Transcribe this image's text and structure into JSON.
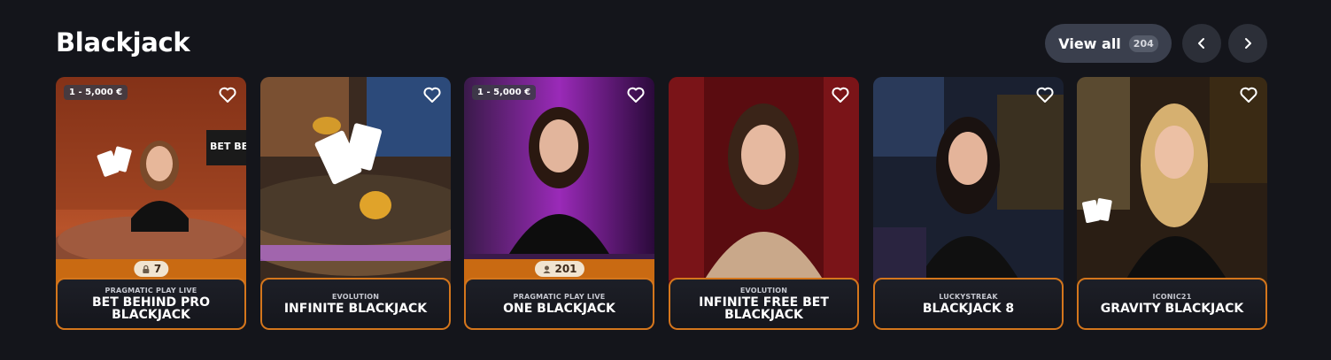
{
  "section": {
    "title": "Blackjack",
    "view_all_label": "View all",
    "view_all_count": "204"
  },
  "icons": {
    "prev": "chevron-left-icon",
    "next": "chevron-right-icon",
    "favorite": "heart-outline-icon",
    "seats_lock": "lock-icon",
    "seats_players": "players-icon"
  },
  "colors": {
    "background": "#14151b",
    "accent_orange": "#d4761c",
    "card_band": "#c96a12"
  },
  "cards": [
    {
      "provider": "PRAGMATIC PLAY LIVE",
      "name": "BET BEHIND PRO BLACKJACK",
      "limits": "1 - 5,000 €",
      "seats": "7",
      "seat_icon": "lock-icon"
    },
    {
      "provider": "EVOLUTION",
      "name": "INFINITE BLACKJACK"
    },
    {
      "provider": "PRAGMATIC PLAY LIVE",
      "name": "ONE BLACKJACK",
      "limits": "1 - 5,000 €",
      "seats": "201",
      "seat_icon": "players-icon"
    },
    {
      "provider": "EVOLUTION",
      "name": "INFINITE FREE BET BLACKJACK"
    },
    {
      "provider": "LUCKYSTREAK",
      "name": "BLACKJACK 8"
    },
    {
      "provider": "ICONIC21",
      "name": "GRAVITY BLACKJACK"
    }
  ]
}
